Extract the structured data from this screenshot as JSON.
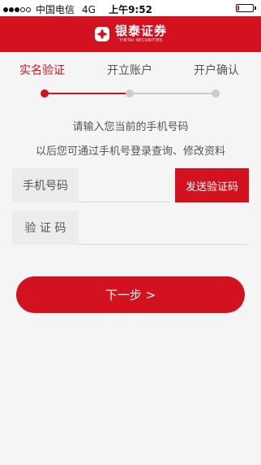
{
  "status_bar": {
    "signal_filled": 3,
    "signal_total": 5,
    "carrier": "中国电信",
    "network": "4G",
    "time": "上午9:52",
    "battery_level": 0.12
  },
  "header": {
    "brand_cn": "银泰证券",
    "brand_en": "YINTAI SECURITIES",
    "background": "#d4121f"
  },
  "steps": {
    "items": [
      {
        "label": "实名验证",
        "active": true
      },
      {
        "label": "开立账户",
        "active": false
      },
      {
        "label": "开户确认",
        "active": false
      }
    ],
    "active_color": "#d4121f",
    "inactive_color": "#cccccc"
  },
  "instructions": {
    "line1": "请输入您当前的手机号码",
    "line2": "以后您可通过手机号登录查询、修改资料"
  },
  "form": {
    "phone_label": "手机号码",
    "phone_value": "",
    "send_code_label": "发送验证码",
    "code_label": "验 证 码",
    "code_value": ""
  },
  "next_button": {
    "label": "下一步 >"
  }
}
